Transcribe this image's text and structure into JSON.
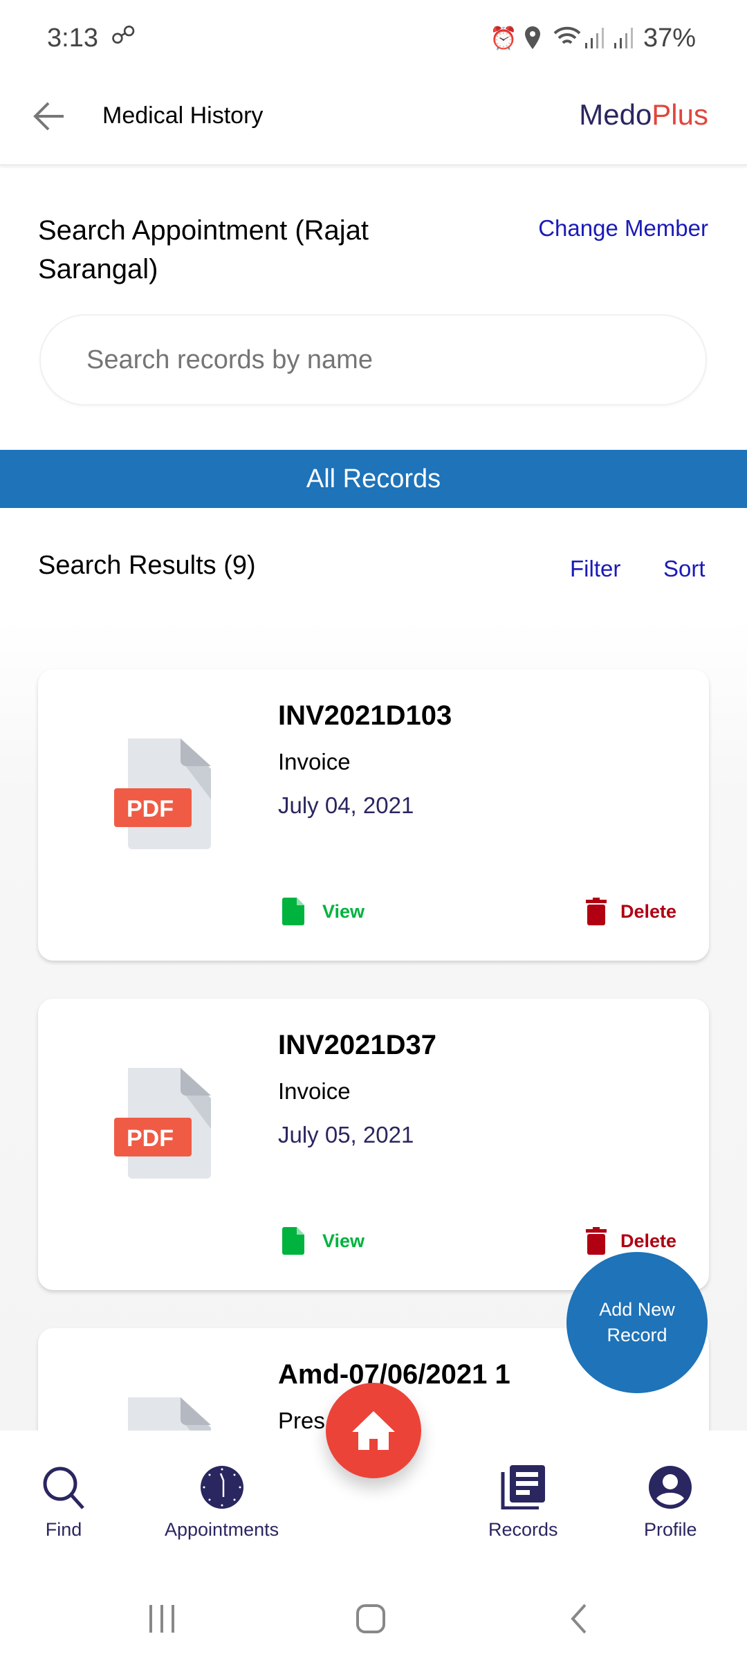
{
  "status_bar": {
    "time": "3:13",
    "battery": "37%",
    "icons": [
      "link-icon",
      "alarm-icon",
      "location-icon",
      "wifi-icon",
      "signal-icon",
      "signal-icon"
    ]
  },
  "header": {
    "title": "Medical History",
    "brand_part1": "Medo",
    "brand_part2": "Plus",
    "brand_colors": {
      "medo": "#2a2660",
      "plus": "#e0463c"
    }
  },
  "search": {
    "title": "Search Appointment (Rajat Sarangal)",
    "change_member": "Change Member",
    "placeholder": "Search records by name",
    "value": ""
  },
  "tab_bar": {
    "label": "All Records",
    "color": "#1e73b9"
  },
  "results": {
    "title": "Search Results (9)",
    "filter": "Filter",
    "sort": "Sort"
  },
  "records": [
    {
      "title": "INV2021D103",
      "type": "Invoice",
      "date": "July 04, 2021",
      "view": "View",
      "delete": "Delete"
    },
    {
      "title": "INV2021D37",
      "type": "Invoice",
      "date": "July 05, 2021",
      "view": "View",
      "delete": "Delete"
    },
    {
      "title": "Amd-07/06/2021 1",
      "type": "Pres"
    }
  ],
  "pdf_label": "PDF",
  "add_button": {
    "line1": "Add New",
    "line2": "Record"
  },
  "bottom_nav": {
    "items": [
      {
        "label": "Find",
        "icon": "search-icon"
      },
      {
        "label": "Appointments",
        "icon": "clock-icon"
      },
      {
        "label": "Records",
        "icon": "records-icon"
      },
      {
        "label": "Profile",
        "icon": "profile-icon"
      }
    ],
    "center_icon": "home-icon"
  }
}
